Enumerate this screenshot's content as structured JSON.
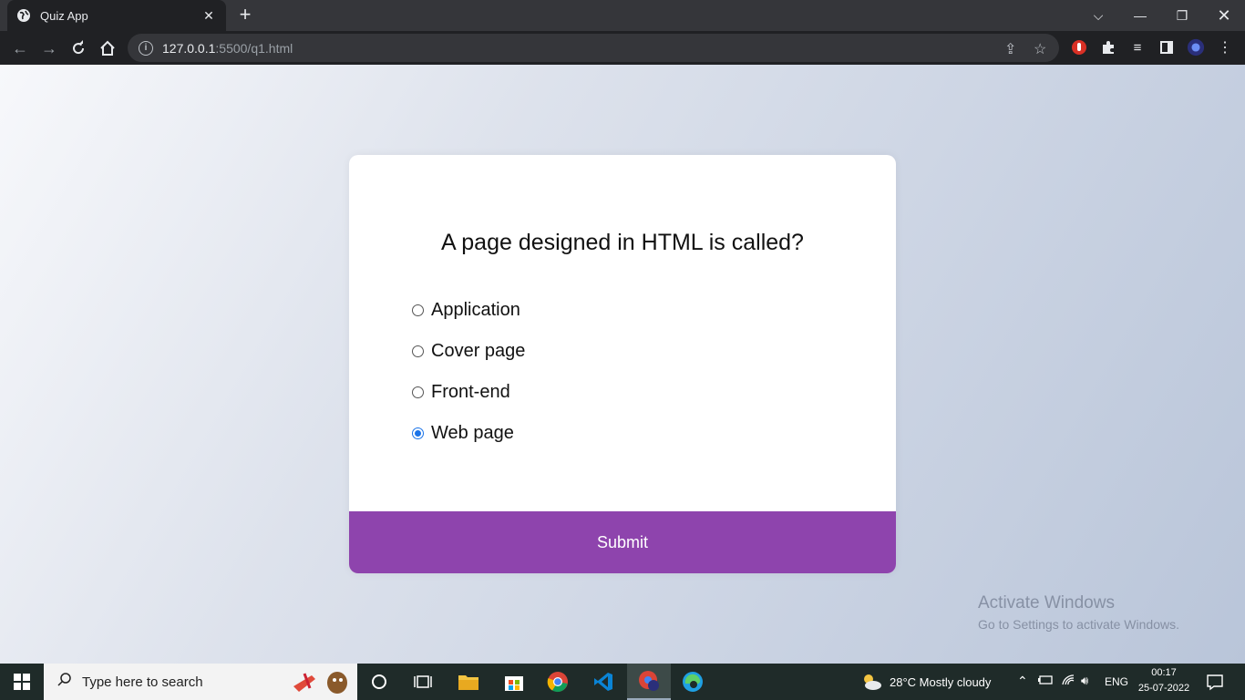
{
  "browser": {
    "tab_title": "Quiz App",
    "url_host": "127.0.0.1",
    "url_path": ":5500/q1.html"
  },
  "quiz": {
    "question": "A page designed in HTML is called?",
    "options": [
      {
        "label": "Application",
        "selected": false
      },
      {
        "label": "Cover page",
        "selected": false
      },
      {
        "label": "Front-end",
        "selected": false
      },
      {
        "label": "Web page",
        "selected": true
      }
    ],
    "submit_label": "Submit",
    "accent_color": "#8e44ad"
  },
  "watermark": {
    "title": "Activate Windows",
    "subtitle": "Go to Settings to activate Windows."
  },
  "taskbar": {
    "search_placeholder": "Type here to search",
    "weather": "28°C  Mostly cloudy",
    "language": "ENG",
    "time": "00:17",
    "date": "25-07-2022"
  }
}
